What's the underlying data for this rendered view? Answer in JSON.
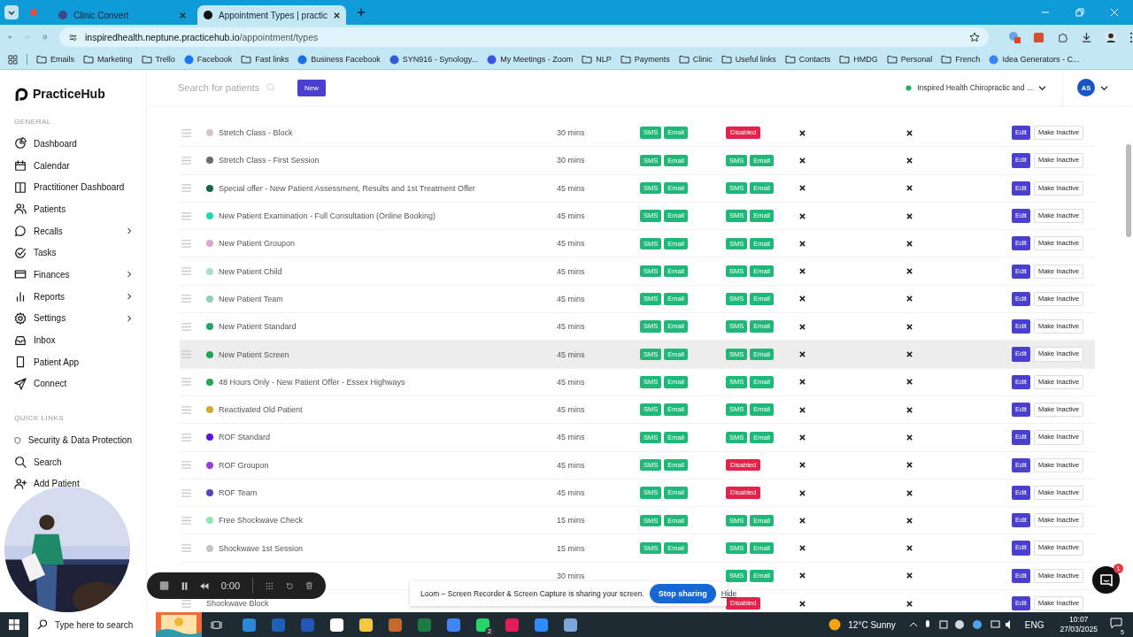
{
  "browser": {
    "tabs": [
      {
        "title": "Clinic Convert",
        "selected": false
      },
      {
        "title": "Appointment Types | practic",
        "selected": true
      }
    ],
    "url": {
      "host": "inspiredhealth.neptune.practicehub.io",
      "path": "/appointment/types"
    },
    "bookmarks": [
      {
        "label": "Emails",
        "kind": "folder"
      },
      {
        "label": "Marketing",
        "kind": "folder"
      },
      {
        "label": "Trello",
        "kind": "folder"
      },
      {
        "label": "Facebook",
        "kind": "site",
        "color": "#1877f2"
      },
      {
        "label": "Fast links",
        "kind": "folder"
      },
      {
        "label": "Business Facebook",
        "kind": "site",
        "color": "#1d6fe0"
      },
      {
        "label": "SYN916 - Synology...",
        "kind": "site",
        "color": "#2f5fd6"
      },
      {
        "label": "My Meetings - Zoom",
        "kind": "site",
        "color": "#3a55e0"
      },
      {
        "label": "NLP",
        "kind": "folder"
      },
      {
        "label": "Payments",
        "kind": "folder"
      },
      {
        "label": "Clinic",
        "kind": "folder"
      },
      {
        "label": "Useful links",
        "kind": "folder"
      },
      {
        "label": "Contacts",
        "kind": "folder"
      },
      {
        "label": "HMDG",
        "kind": "folder"
      },
      {
        "label": "Personal",
        "kind": "folder"
      },
      {
        "label": "French",
        "kind": "folder"
      },
      {
        "label": "Idea Generators - C...",
        "kind": "site",
        "color": "#3b82f6"
      }
    ]
  },
  "brand": "PracticeHub",
  "header": {
    "search_placeholder": "Search for patients",
    "new_button": "New",
    "clinic": "Inspired Health Chiropractic and ...",
    "avatar": "AS"
  },
  "sidebar": [
    {
      "heading": "GENERAL",
      "items": [
        {
          "label": "Dashboard",
          "submenu": false
        },
        {
          "label": "Calendar",
          "submenu": false
        },
        {
          "label": "Practitioner Dashboard",
          "submenu": false
        },
        {
          "label": "Patients",
          "submenu": false
        },
        {
          "label": "Recalls",
          "submenu": true
        },
        {
          "label": "Tasks",
          "submenu": false
        },
        {
          "label": "Finances",
          "submenu": true
        },
        {
          "label": "Reports",
          "submenu": true
        },
        {
          "label": "Settings",
          "submenu": true
        },
        {
          "label": "Inbox",
          "submenu": false
        },
        {
          "label": "Patient App",
          "submenu": false
        },
        {
          "label": "Connect",
          "submenu": false
        }
      ]
    },
    {
      "heading": "QUICK LINKS",
      "items": [
        {
          "label": "Security & Data Protection",
          "submenu": false
        },
        {
          "label": "Search",
          "submenu": false
        },
        {
          "label": "Add Patient",
          "submenu": false
        }
      ]
    }
  ],
  "rows": [
    {
      "name": "Stretch Class - Block",
      "color": "#d9c2d6",
      "duration": "30 mins",
      "reminder": {
        "kind": "channels",
        "labels": [
          "SMS",
          "Email"
        ]
      },
      "confirmation": {
        "kind": "disabled",
        "labels": [
          "Disabled"
        ]
      },
      "actions": [
        "Edit",
        "Make Inactive"
      ],
      "highlighted": false
    },
    {
      "name": "Stretch Class - First Session",
      "color": "#6b6b70",
      "duration": "30 mins",
      "reminder": {
        "kind": "channels",
        "labels": [
          "SMS",
          "Email"
        ]
      },
      "confirmation": {
        "kind": "channels",
        "labels": [
          "SMS",
          "Email"
        ]
      },
      "actions": [
        "Edit",
        "Make Inactive"
      ],
      "highlighted": false
    },
    {
      "name": "Special offer - New Patient Assessment, Results and 1st Treatment Offer",
      "color": "#16664a",
      "duration": "45 mins",
      "reminder": {
        "kind": "channels",
        "labels": [
          "SMS",
          "Email"
        ]
      },
      "confirmation": {
        "kind": "channels",
        "labels": [
          "SMS",
          "Email"
        ]
      },
      "actions": [
        "Edit",
        "Make Inactive"
      ],
      "highlighted": false
    },
    {
      "name": "New Patient Examination - Full Consultation (Online Booking)",
      "color": "#22d8a8",
      "duration": "45 mins",
      "reminder": {
        "kind": "channels",
        "labels": [
          "SMS",
          "Email"
        ]
      },
      "confirmation": {
        "kind": "channels",
        "labels": [
          "SMS",
          "Email"
        ]
      },
      "actions": [
        "Edit",
        "Make Inactive"
      ],
      "highlighted": false
    },
    {
      "name": "New Patient Groupon",
      "color": "#d9a8d2",
      "duration": "45 mins",
      "reminder": {
        "kind": "channels",
        "labels": [
          "SMS",
          "Email"
        ]
      },
      "confirmation": {
        "kind": "channels",
        "labels": [
          "SMS",
          "Email"
        ]
      },
      "actions": [
        "Edit",
        "Make Inactive"
      ],
      "highlighted": false
    },
    {
      "name": "New Patient Child",
      "color": "#a8e0c4",
      "duration": "45 mins",
      "reminder": {
        "kind": "channels",
        "labels": [
          "SMS",
          "Email"
        ]
      },
      "confirmation": {
        "kind": "channels",
        "labels": [
          "SMS",
          "Email"
        ]
      },
      "actions": [
        "Edit",
        "Make Inactive"
      ],
      "highlighted": false
    },
    {
      "name": "New Patient Team",
      "color": "#8fd1b0",
      "duration": "45 mins",
      "reminder": {
        "kind": "channels",
        "labels": [
          "SMS",
          "Email"
        ]
      },
      "confirmation": {
        "kind": "channels",
        "labels": [
          "SMS",
          "Email"
        ]
      },
      "actions": [
        "Edit",
        "Make Inactive"
      ],
      "highlighted": false
    },
    {
      "name": "New Patient Standard",
      "color": "#1fa55c",
      "duration": "45 mins",
      "reminder": {
        "kind": "channels",
        "labels": [
          "SMS",
          "Email"
        ]
      },
      "confirmation": {
        "kind": "channels",
        "labels": [
          "SMS",
          "Email"
        ]
      },
      "actions": [
        "Edit",
        "Make Inactive"
      ],
      "highlighted": false
    },
    {
      "name": "New Patient Screen",
      "color": "#1fa55c",
      "duration": "45 mins",
      "reminder": {
        "kind": "channels",
        "labels": [
          "SMS",
          "Email"
        ]
      },
      "confirmation": {
        "kind": "channels",
        "labels": [
          "SMS",
          "Email"
        ]
      },
      "actions": [
        "Edit",
        "Make Inactive"
      ],
      "highlighted": true
    },
    {
      "name": "48 Hours Only - New Patient Offer - Essex Highways",
      "color": "#1fa55c",
      "duration": "45 mins",
      "reminder": {
        "kind": "channels",
        "labels": [
          "SMS",
          "Email"
        ]
      },
      "confirmation": {
        "kind": "channels",
        "labels": [
          "SMS",
          "Email"
        ]
      },
      "actions": [
        "Edit",
        "Make Inactive"
      ],
      "highlighted": false
    },
    {
      "name": "Reactivated Old Patient",
      "color": "#d4a82a",
      "duration": "45 mins",
      "reminder": {
        "kind": "channels",
        "labels": [
          "SMS",
          "Email"
        ]
      },
      "confirmation": {
        "kind": "channels",
        "labels": [
          "SMS",
          "Email"
        ]
      },
      "actions": [
        "Edit",
        "Make Inactive"
      ],
      "highlighted": false
    },
    {
      "name": "ROF Standard",
      "color": "#5b10e8",
      "duration": "45 mins",
      "reminder": {
        "kind": "channels",
        "labels": [
          "SMS",
          "Email"
        ]
      },
      "confirmation": {
        "kind": "channels",
        "labels": [
          "SMS",
          "Email"
        ]
      },
      "actions": [
        "Edit",
        "Make Inactive"
      ],
      "highlighted": false
    },
    {
      "name": "ROF Groupon",
      "color": "#9b3ee0",
      "duration": "45 mins",
      "reminder": {
        "kind": "channels",
        "labels": [
          "SMS",
          "Email"
        ]
      },
      "confirmation": {
        "kind": "disabled",
        "labels": [
          "Disabled"
        ]
      },
      "actions": [
        "Edit",
        "Make Inactive"
      ],
      "highlighted": false
    },
    {
      "name": "ROF Team",
      "color": "#5646b8",
      "duration": "45 mins",
      "reminder": {
        "kind": "channels",
        "labels": [
          "SMS",
          "Email"
        ]
      },
      "confirmation": {
        "kind": "disabled",
        "labels": [
          "Disabled"
        ]
      },
      "actions": [
        "Edit",
        "Make Inactive"
      ],
      "highlighted": false
    },
    {
      "name": "Free Shockwave Check",
      "color": "#90eab0",
      "duration": "15 mins",
      "reminder": {
        "kind": "channels",
        "labels": [
          "SMS",
          "Email"
        ]
      },
      "confirmation": {
        "kind": "channels",
        "labels": [
          "SMS",
          "Email"
        ]
      },
      "actions": [
        "Edit",
        "Make Inactive"
      ],
      "highlighted": false
    },
    {
      "name": "Shockwave 1st Session",
      "color": "#c4c4c4",
      "duration": "15 mins",
      "reminder": {
        "kind": "channels",
        "labels": [
          "SMS",
          "Email"
        ]
      },
      "confirmation": {
        "kind": "channels",
        "labels": [
          "SMS",
          "Email"
        ]
      },
      "actions": [
        "Edit",
        "Make Inactive"
      ],
      "highlighted": false
    },
    {
      "duration": "30 mins",
      "confirmation": {
        "kind": "channels",
        "labels": [
          "SMS",
          "Email"
        ]
      },
      "actions": [
        "Edit",
        "Make Inactive"
      ],
      "highlighted": false
    },
    {
      "name": "Shockwave Block",
      "confirmation": {
        "kind": "disabled",
        "labels": [
          "Disabled"
        ]
      },
      "actions": [
        "Edit",
        "Make Inactive"
      ],
      "highlighted": false
    }
  ],
  "recorder": {
    "time": "0:00"
  },
  "share_banner": {
    "message": "Loom – Screen Recorder & Screen Capture is sharing your screen.",
    "stop": "Stop sharing",
    "hide": "Hide"
  },
  "chat": {
    "badge": "1"
  },
  "taskbar": {
    "search_placeholder": "Type here to search",
    "app_badge": "2",
    "weather": "12°C Sunny",
    "language": "ENG",
    "time": "10:07",
    "date": "27/03/2025",
    "notifications": "5"
  }
}
